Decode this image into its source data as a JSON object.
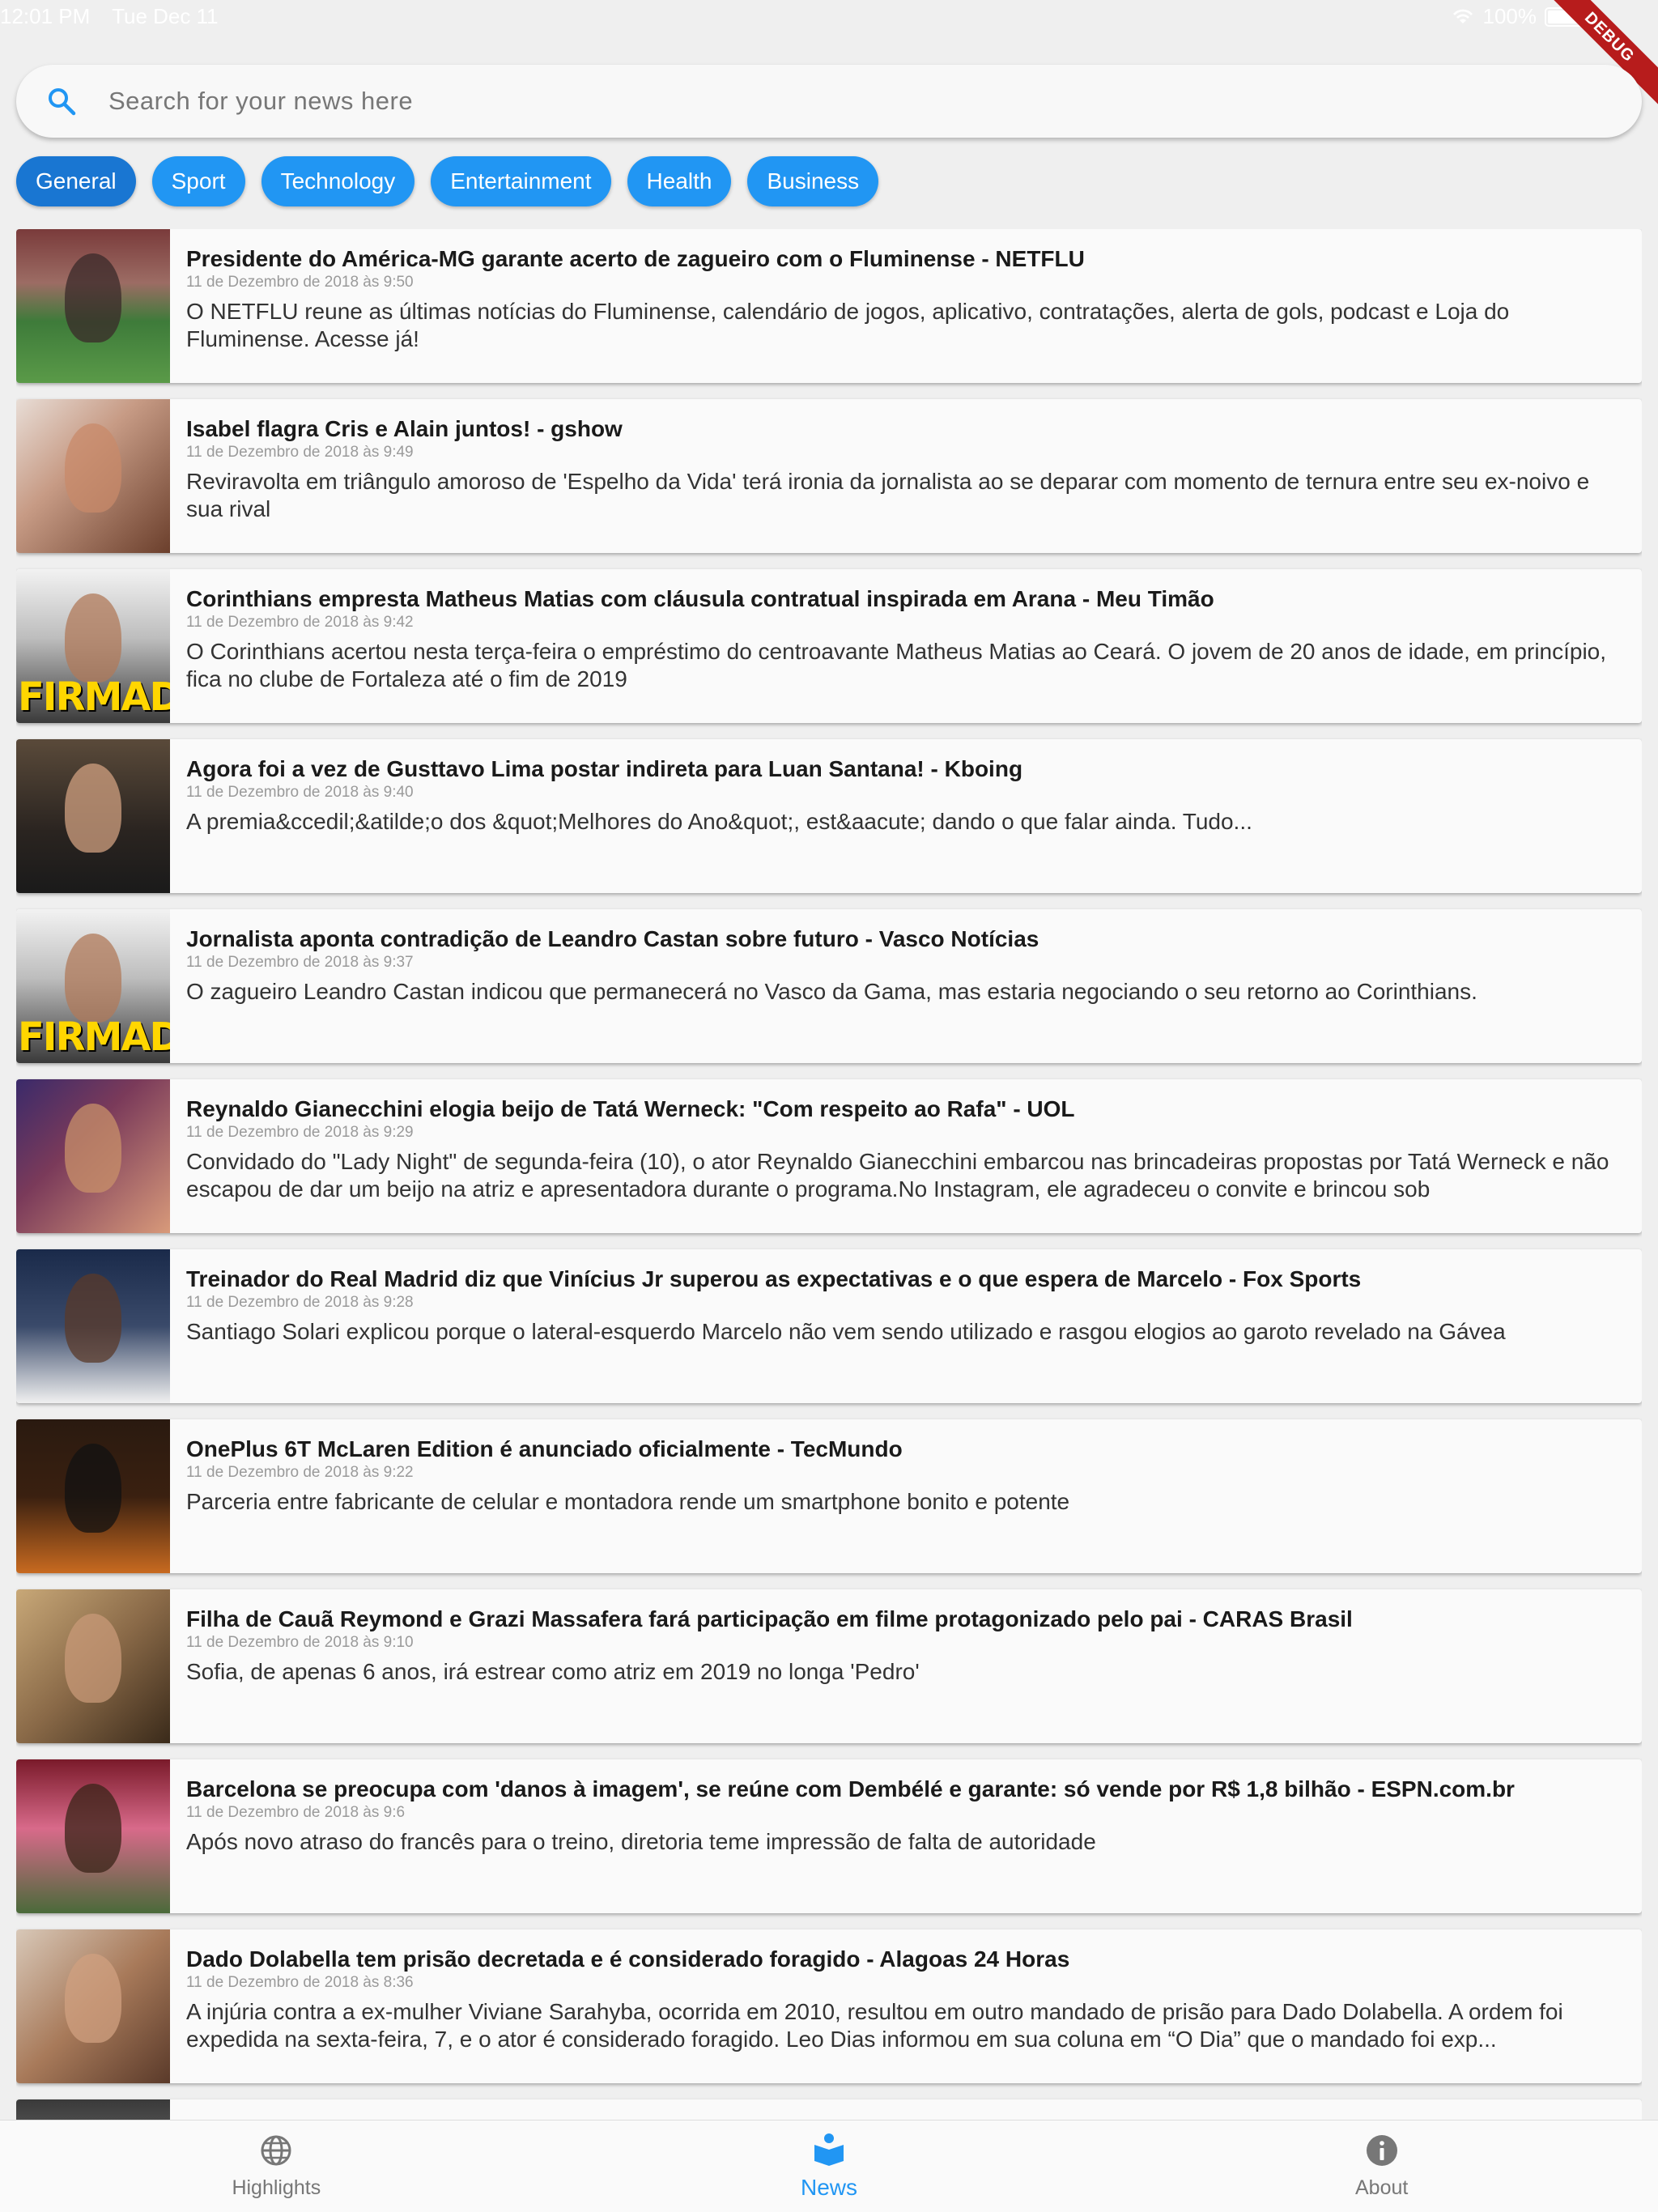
{
  "status": {
    "time": "12:01 PM",
    "date": "Tue Dec 11",
    "battery": "100%",
    "debug": "DEBUG"
  },
  "search": {
    "placeholder": "Search for your news here",
    "value": ""
  },
  "categories": [
    "General",
    "Sport",
    "Technology",
    "Entertainment",
    "Health",
    "Business"
  ],
  "active_category": "General",
  "articles": [
    {
      "title": "Presidente do América-MG garante acerto de zagueiro com o Fluminense - NETFLU",
      "date": "11 de Dezembro de 2018 às 9:50",
      "description": "O NETFLU reune as últimas notícias do Fluminense, calendário de jogos, aplicativo, contratações, alerta de gols, podcast e Loja do Fluminense. Acesse já!"
    },
    {
      "title": "Isabel flagra Cris e Alain juntos! - gshow",
      "date": "11 de Dezembro de 2018 às 9:49",
      "description": "Reviravolta em triângulo amoroso de 'Espelho da Vida' terá ironia da jornalista ao se deparar com momento de ternura entre seu ex-noivo e sua rival"
    },
    {
      "title": "Corinthians empresta Matheus Matias com cláusula contratual inspirada em Arana - Meu Timão",
      "date": "11 de Dezembro de 2018 às 9:42",
      "description": "O Corinthians acertou nesta terça-feira o empréstimo do centroavante Matheus Matias ao Ceará. O jovem de 20 anos de idade, em princípio, fica no clube de Fortaleza até o fim de 2019",
      "overlay": "FIRMADO!"
    },
    {
      "title": "Agora foi a vez de Gusttavo Lima postar indireta para Luan Santana! - Kboing",
      "date": "11 de Dezembro de 2018 às 9:40",
      "description": "A premia&ccedil;&atilde;o dos &quot;Melhores do Ano&quot;, est&aacute; dando o que falar ainda. Tudo..."
    },
    {
      "title": "Jornalista aponta contradição de Leandro Castan sobre futuro - Vasco Notícias",
      "date": "11 de Dezembro de 2018 às 9:37",
      "description": "O zagueiro Leandro Castan indicou que permanecerá no Vasco da Gama, mas estaria negociando o seu retorno ao Corinthians.",
      "overlay": "FIRMADO!"
    },
    {
      "title": "Reynaldo Gianecchini elogia beijo de Tatá Werneck: \"Com respeito ao Rafa\" - UOL",
      "date": "11 de Dezembro de 2018 às 9:29",
      "description": "Convidado do \"Lady Night\" de segunda-feira (10), o ator Reynaldo Gianecchini embarcou nas brincadeiras propostas por Tatá Werneck e não escapou de dar um beijo na atriz e apresentadora durante o programa.No Instagram, ele agradeceu o convite e brincou sob"
    },
    {
      "title": "Treinador do Real Madrid diz que Vinícius Jr superou as expectativas e o que espera de Marcelo - Fox Sports",
      "date": "11 de Dezembro de 2018 às 9:28",
      "description": "Santiago Solari explicou porque o lateral-esquerdo Marcelo não vem sendo utilizado e rasgou elogios ao garoto revelado na Gávea"
    },
    {
      "title": "OnePlus 6T McLaren Edition é anunciado oficialmente - TecMundo",
      "date": "11 de Dezembro de 2018 às 9:22",
      "description": "Parceria entre fabricante de celular e montadora rende um smartphone bonito e potente"
    },
    {
      "title": "Filha de Cauã Reymond e Grazi Massafera fará participação em filme protagonizado pelo pai - CARAS Brasil",
      "date": "11 de Dezembro de 2018 às 9:10",
      "description": "Sofia, de apenas 6 anos, irá estrear como atriz em 2019 no longa 'Pedro'"
    },
    {
      "title": "Barcelona se preocupa com 'danos à imagem', se reúne com Dembélé e garante: só vende por R$ 1,8 bilhão - ESPN.com.br",
      "date": "11 de Dezembro de 2018 às 9:6",
      "description": "Após novo atraso do francês para o treino, diretoria teme impressão de falta de autoridade"
    },
    {
      "title": "Dado Dolabella tem prisão decretada e é considerado foragido - Alagoas 24 Horas",
      "date": "11 de Dezembro de 2018 às 8:36",
      "description": "A injúria contra a ex-mulher Viviane Sarahyba, ocorrida em 2010, resultou em outro mandado de prisão para Dado Dolabella. A ordem foi expedida na sexta-feira, 7, e o ator é considerado foragido. Leo Dias informou em sua coluna em “O Dia” que o mandado foi exp..."
    },
    {
      "title": "",
      "date": "",
      "description": ""
    }
  ],
  "bottom_nav": [
    {
      "label": "Highlights",
      "icon": "globe-icon",
      "active": false
    },
    {
      "label": "News",
      "icon": "news-reader-icon",
      "active": true
    },
    {
      "label": "About",
      "icon": "info-icon",
      "active": false
    }
  ],
  "colors": {
    "accent": "#2196f3",
    "chip_active": "#1976d2",
    "background": "#efefef"
  }
}
